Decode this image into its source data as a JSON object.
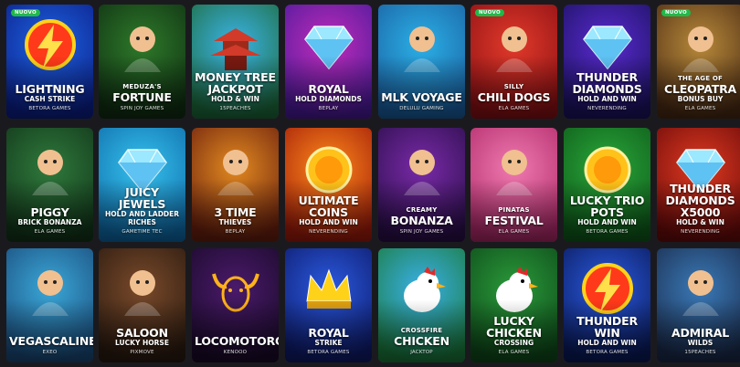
{
  "rows": [
    [
      {
        "id": "lightning",
        "pre": "",
        "title": "LIGHTNING",
        "sub": "CASH STRIKE",
        "provider": "BETORA GAMES",
        "badge": "NUOVO",
        "bg": [
          "#1e63e0",
          "#0b1f8a"
        ],
        "icon": "lightning-bolt-icon"
      },
      {
        "id": "meduza",
        "pre": "MEDUZA'S",
        "title": "FORTUNE",
        "sub": "",
        "provider": "SPIN JOY GAMES",
        "badge": "",
        "bg": [
          "#2e7a2a",
          "#0f2e12"
        ],
        "icon": "medusa-icon"
      },
      {
        "id": "money-tree",
        "pre": "",
        "title": "MONEY TREE JACKPOT",
        "sub": "HOLD & WIN",
        "provider": "15PEACHES",
        "badge": "",
        "bg": [
          "#3bb4e8",
          "#1d6a3a"
        ],
        "icon": "pagoda-icon"
      },
      {
        "id": "royal-diamonds",
        "pre": "",
        "title": "ROYAL",
        "sub": "HOLD DIAMONDS",
        "provider": "BEPLAY",
        "badge": "",
        "bg": [
          "#c02cb8",
          "#4a1a9c"
        ],
        "icon": "diamond-icon"
      },
      {
        "id": "mlk-voyage",
        "pre": "",
        "title": "MLK VOYAGE",
        "sub": "",
        "provider": "DELULU GAMING",
        "badge": "",
        "bg": [
          "#2bb0e6",
          "#1a5ea0"
        ],
        "icon": "sailor-icon"
      },
      {
        "id": "chili-dogs",
        "pre": "SILLY",
        "title": "CHILI DOGS",
        "sub": "",
        "provider": "ELA GAMES",
        "badge": "NUOVO",
        "bg": [
          "#e23a2a",
          "#8a0f14"
        ],
        "icon": "chihuahua-icon"
      },
      {
        "id": "thunder-diamonds",
        "pre": "",
        "title": "THUNDER DIAMONDS",
        "sub": "HOLD AND WIN",
        "provider": "NEVERENDING",
        "badge": "",
        "bg": [
          "#5a2ad0",
          "#1b1260"
        ],
        "icon": "diamond-icon"
      },
      {
        "id": "cleopatra",
        "pre": "THE AGE OF",
        "title": "CLEOPATRA",
        "sub": "BONUS BUY",
        "provider": "ELA GAMES",
        "badge": "NUOVO",
        "bg": [
          "#b88a3a",
          "#4a2a14"
        ],
        "icon": "cleopatra-icon"
      }
    ],
    [
      {
        "id": "piggy",
        "pre": "",
        "title": "PIGGY",
        "sub": "BRICK BONANZA",
        "provider": "ELA GAMES",
        "badge": "",
        "bg": [
          "#2f7a3c",
          "#12351a"
        ],
        "icon": "pig-icon"
      },
      {
        "id": "juicy-jewels",
        "pre": "",
        "title": "JUICY JEWELS",
        "sub": "HOLD AND LADDER RICHES",
        "provider": "GAMETIME TEC",
        "badge": "",
        "bg": [
          "#36c3ee",
          "#0e6aa8"
        ],
        "icon": "diamond-777-icon"
      },
      {
        "id": "3-time-thieves",
        "pre": "",
        "title": "3 TIME",
        "sub": "THIEVES",
        "provider": "BEPLAY",
        "badge": "",
        "bg": [
          "#e28a20",
          "#6a1e0e"
        ],
        "icon": "magician-icon"
      },
      {
        "id": "ultimate-coins",
        "pre": "",
        "title": "ULTIMATE COINS",
        "sub": "HOLD AND WIN",
        "provider": "NEVERENDING",
        "badge": "",
        "bg": [
          "#ff8a1a",
          "#a01a0a"
        ],
        "icon": "coin-icon"
      },
      {
        "id": "creamy-bonanza",
        "pre": "CREAMY",
        "title": "BONANZA",
        "sub": "",
        "provider": "SPIN JOY GAMES",
        "badge": "",
        "bg": [
          "#7a2aa8",
          "#2a0e4a"
        ],
        "icon": "showgirl-icon"
      },
      {
        "id": "pinatas-festival",
        "pre": "PINATAS",
        "title": "FESTIVAL",
        "sub": "",
        "provider": "ELA GAMES",
        "badge": "",
        "bg": [
          "#f07ab0",
          "#b02a6a"
        ],
        "icon": "pinata-icon"
      },
      {
        "id": "lucky-trio-pots",
        "pre": "",
        "title": "LUCKY TRIO POTS",
        "sub": "HOLD AND WIN",
        "provider": "BETORA GAMES",
        "badge": "",
        "bg": [
          "#2aa83a",
          "#0e5a1a"
        ],
        "icon": "gold-pot-icon"
      },
      {
        "id": "thunder-diamonds-x5000",
        "pre": "",
        "title": "THUNDER DIAMONDS X5000",
        "sub": "HOLD & WIN",
        "provider": "NEVERENDING",
        "badge": "",
        "bg": [
          "#e03a20",
          "#6a0a0a"
        ],
        "icon": "diamond-icon"
      }
    ],
    [
      {
        "id": "vegascaline",
        "pre": "",
        "title": "VEGASCALINE",
        "sub": "",
        "provider": "EXEO",
        "badge": "",
        "bg": [
          "#3aa8d8",
          "#1a4a7a"
        ],
        "icon": "sheriff-icon"
      },
      {
        "id": "saloon-lucky-horse",
        "pre": "",
        "title": "SALOON",
        "sub": "LUCKY HORSE",
        "provider": "PIXMOVE",
        "badge": "",
        "bg": [
          "#7a4a2a",
          "#2a1a10"
        ],
        "icon": "horse-icon"
      },
      {
        "id": "locomotoro",
        "pre": "",
        "title": "LOCOMOTORO",
        "sub": "",
        "provider": "KENOOO",
        "badge": "",
        "bg": [
          "#4a1a6a",
          "#1a0a2a"
        ],
        "icon": "bull-icon"
      },
      {
        "id": "royal-strike",
        "pre": "",
        "title": "ROYAL",
        "sub": "STRIKE",
        "provider": "BETORA GAMES",
        "badge": "",
        "bg": [
          "#2a5ae0",
          "#0e1a6a"
        ],
        "icon": "crown-icon"
      },
      {
        "id": "crossfire-chicken",
        "pre": "CROSSFIRE",
        "title": "CHICKEN",
        "sub": "",
        "provider": "JACKTOP",
        "badge": "",
        "bg": [
          "#3ab0e8",
          "#1a7a3a"
        ],
        "icon": "chicken-icon"
      },
      {
        "id": "lucky-chicken",
        "pre": "",
        "title": "LUCKY CHICKEN",
        "sub": "CROSSING",
        "provider": "ELA GAMES",
        "badge": "",
        "bg": [
          "#2a9a3a",
          "#0e4a1a"
        ],
        "icon": "chicken-icon"
      },
      {
        "id": "thunder-win",
        "pre": "",
        "title": "THUNDER WIN",
        "sub": "HOLD AND WIN",
        "provider": "BETORA GAMES",
        "badge": "",
        "bg": [
          "#2a5ae0",
          "#0a1a5a"
        ],
        "icon": "thunder-logo-icon"
      },
      {
        "id": "admiral-wilds",
        "pre": "",
        "title": "ADMIRAL",
        "sub": "WILDS",
        "provider": "15PEACHES",
        "badge": "",
        "bg": [
          "#3a7ab8",
          "#1a2a4a"
        ],
        "icon": "admiral-icon"
      }
    ]
  ]
}
